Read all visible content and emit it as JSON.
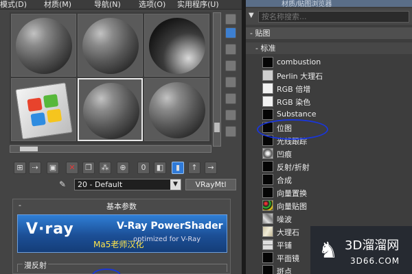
{
  "menubar": {
    "items": [
      "模式(D)",
      "材质(M)",
      "导航(N)",
      "选项(O)",
      "实用程序(U)"
    ]
  },
  "material": {
    "name": "20 - Default",
    "type": "VRayMtl"
  },
  "params": {
    "rollout_title": "基本参数",
    "collapse_symbol": "-",
    "banner": {
      "logo": "V·ray",
      "title": "V-Ray PowerShader",
      "subtitle": "optimized for V-Ray",
      "credit": "Ma5老师汉化"
    },
    "diffuse_group": "漫反射"
  },
  "map_browser": {
    "title": "材质/贴图浏览器",
    "search_placeholder": "按名称搜索...",
    "category": "- 贴图",
    "subcategory": "- 标准",
    "items": [
      {
        "label": "combustion",
        "icon": "black-swatch"
      },
      {
        "label": "Perlin 大理石",
        "icon": "marble-swatch"
      },
      {
        "label": "RGB 倍增",
        "icon": "white-swatch"
      },
      {
        "label": "RGB 染色",
        "icon": "white-swatch"
      },
      {
        "label": "Substance",
        "icon": "black-swatch"
      },
      {
        "label": "位图",
        "icon": "black-swatch"
      },
      {
        "label": "光线跟踪",
        "icon": "black-swatch"
      },
      {
        "label": "凹痕",
        "icon": "dent-swatch"
      },
      {
        "label": "反射/折射",
        "icon": "black-swatch"
      },
      {
        "label": "合成",
        "icon": "black-swatch"
      },
      {
        "label": "向量置换",
        "icon": "black-swatch"
      },
      {
        "label": "向量贴图",
        "icon": "vector-swatch"
      },
      {
        "label": "噪波",
        "icon": "noise-swatch"
      },
      {
        "label": "大理石",
        "icon": "marble-swatch"
      },
      {
        "label": "平铺",
        "icon": "tile-swatch"
      },
      {
        "label": "平面镜",
        "icon": "black-swatch"
      },
      {
        "label": "斑点",
        "icon": "black-swatch"
      }
    ],
    "annotation_color": "#1a36d8"
  },
  "watermark": {
    "main": "3D溜溜网",
    "sub": "3D66.COM"
  },
  "colors": {
    "vray_blue": "#2f7fd6",
    "credit_yellow": "#ffe64a",
    "selected_tool_blue": "#2f7ad8"
  }
}
